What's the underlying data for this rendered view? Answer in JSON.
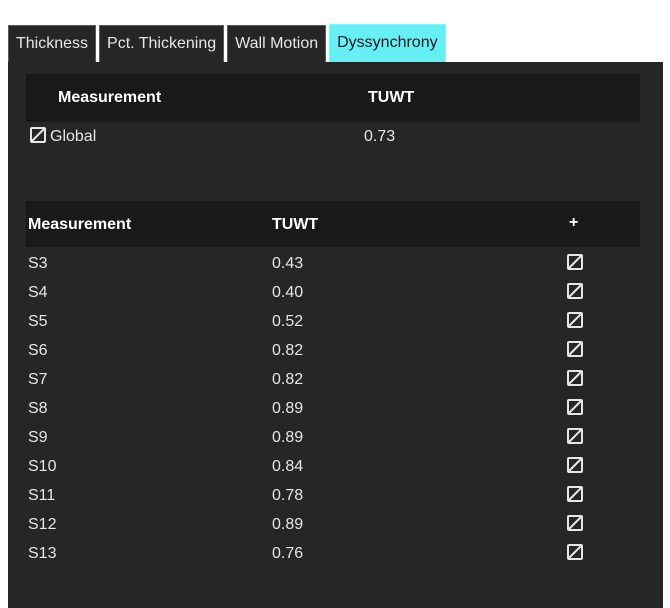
{
  "tabs": [
    {
      "label": "Thickness"
    },
    {
      "label": "Pct. Thickening"
    },
    {
      "label": "Wall Motion"
    },
    {
      "label": "Dyssynchrony",
      "active": true
    }
  ],
  "global_table": {
    "col_measurement": "Measurement",
    "col_tuwt": "TUWT",
    "row": {
      "label": "Global",
      "value": "0.73",
      "checked": true
    }
  },
  "segment_table": {
    "col_measurement": "Measurement",
    "col_tuwt": "TUWT",
    "col_add": "+",
    "rows": [
      {
        "segment": "S3",
        "value": "0.43"
      },
      {
        "segment": "S4",
        "value": "0.40"
      },
      {
        "segment": "S5",
        "value": "0.52"
      },
      {
        "segment": "S6",
        "value": "0.82"
      },
      {
        "segment": "S7",
        "value": "0.82"
      },
      {
        "segment": "S8",
        "value": "0.89"
      },
      {
        "segment": "S9",
        "value": "0.89"
      },
      {
        "segment": "S10",
        "value": "0.84"
      },
      {
        "segment": "S11",
        "value": "0.78"
      },
      {
        "segment": "S12",
        "value": "0.89"
      },
      {
        "segment": "S13",
        "value": "0.76"
      }
    ]
  },
  "colors": {
    "panel_bg": "#262626",
    "header_bg": "#191919",
    "active_tab": "#66f0f6",
    "text": "#e6e6e6"
  }
}
